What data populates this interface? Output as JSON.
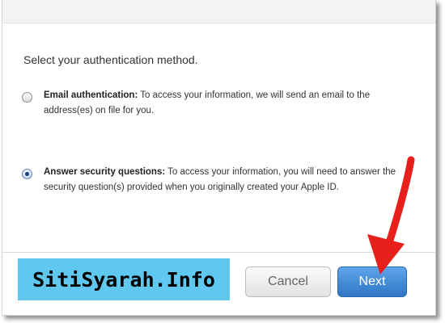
{
  "prompt": "Select your authentication method.",
  "options": [
    {
      "title": "Email authentication:",
      "description": " To access your information, we will send an email to the address(es) on file for you.",
      "selected": false
    },
    {
      "title": "Answer security questions:",
      "description": " To access your information, you will need to answer the security question(s) provided when you originally created your Apple ID.",
      "selected": true
    }
  ],
  "buttons": {
    "cancel_label": "Cancel",
    "next_label": "Next"
  },
  "watermark": {
    "text": "SitiSyarah.Info",
    "background": "#60c8ef"
  },
  "annotation": {
    "icon": "red-arrow-icon",
    "color": "#e8201c"
  },
  "colors": {
    "next_button": "#3b82d0",
    "cancel_button": "#e8e8e8"
  }
}
